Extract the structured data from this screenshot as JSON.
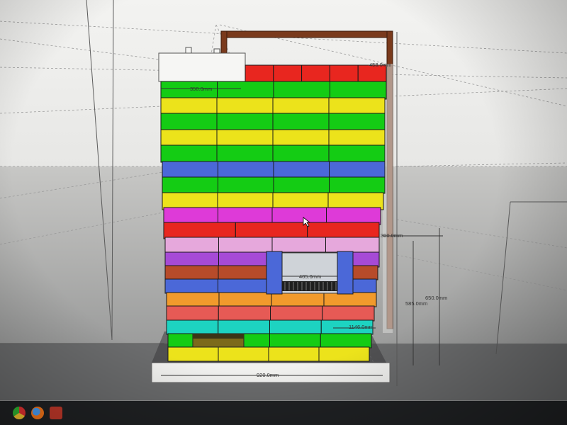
{
  "app": {
    "name": "3D modeling viewport",
    "dimensions": {
      "top_width": "458.0mm",
      "top_left": "350.0mm",
      "right_upper": "300.0mm",
      "door_width": "405.0mm",
      "right_height_outer": "650.0mm",
      "right_height_inner": "585.0mm",
      "depth": "1146.0mm",
      "base_width": "920.0mm"
    }
  },
  "colors": {
    "red": "#e8261f",
    "green": "#14cc14",
    "yellow": "#ece31b",
    "blue": "#4b68d8",
    "magenta": "#de3ad8",
    "pink": "#e6a8dc",
    "purple": "#a64ad6",
    "brown": "#b74b2a",
    "orange": "#f19a2c",
    "coral": "#e65a55",
    "cyan": "#1dd3c1",
    "frame": "#7a3a1c",
    "plate": "#f1f1ef"
  },
  "taskbar": {
    "icons": [
      "chrome-icon",
      "firefox-icon",
      "sketchup-icon"
    ]
  }
}
